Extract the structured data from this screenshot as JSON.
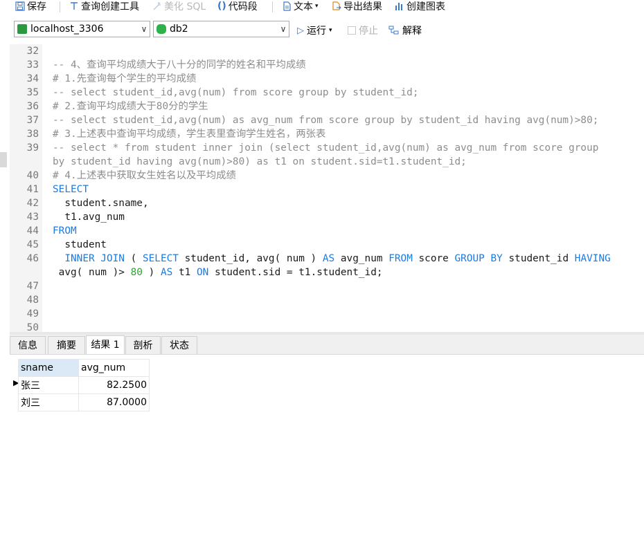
{
  "toolbar": {
    "save": "保存",
    "query_builder": "查询创建工具",
    "beautify_sql": "美化 SQL",
    "code_snippet": "代码段",
    "text": "文本",
    "export_result": "导出结果",
    "create_chart": "创建图表"
  },
  "selectors": {
    "connection": "localhost_3306",
    "database": "db2",
    "run": "运行",
    "stop": "停止",
    "explain": "解释"
  },
  "editor": {
    "lines": [
      {
        "n": "32",
        "tokens": []
      },
      {
        "n": "33",
        "tokens": [
          {
            "t": "-- 4、查询平均成绩大于八十分的同学的姓名和平均成绩",
            "c": "cm"
          }
        ]
      },
      {
        "n": "34",
        "tokens": [
          {
            "t": "# 1.先查询每个学生的平均成绩",
            "c": "cm"
          }
        ]
      },
      {
        "n": "35",
        "tokens": [
          {
            "t": "-- select student_id,avg(num) from score group by student_id;",
            "c": "cm"
          }
        ]
      },
      {
        "n": "36",
        "tokens": [
          {
            "t": "# 2.查询平均成绩大于80分的学生",
            "c": "cm"
          }
        ]
      },
      {
        "n": "37",
        "tokens": [
          {
            "t": "-- select student_id,avg(num) as avg_num from score group by student_id having avg(num)>80;",
            "c": "cm"
          }
        ]
      },
      {
        "n": "38",
        "tokens": [
          {
            "t": "# 3.上述表中查询平均成绩，学生表里查询学生姓名，两张表",
            "c": "cm"
          }
        ]
      },
      {
        "n": "39",
        "tokens": [
          {
            "t": "-- select * from student inner join (select student_id,avg(num) as avg_num from score group",
            "c": "cm"
          }
        ]
      },
      {
        "n": "",
        "tokens": [
          {
            "t": "by student_id having avg(num)>80) as t1 on student.sid=t1.student_id;",
            "c": "cm"
          }
        ]
      },
      {
        "n": "40",
        "tokens": [
          {
            "t": "# 4.上述表中获取女生姓名以及平均成绩",
            "c": "cm"
          }
        ]
      },
      {
        "n": "41",
        "tokens": [
          {
            "t": "SELECT",
            "c": "kw"
          }
        ]
      },
      {
        "n": "42",
        "tokens": [
          {
            "t": "  student.sname,",
            "c": "tx"
          }
        ]
      },
      {
        "n": "43",
        "tokens": [
          {
            "t": "  t1.avg_num",
            "c": "tx"
          }
        ]
      },
      {
        "n": "44",
        "tokens": [
          {
            "t": "FROM",
            "c": "kw"
          }
        ]
      },
      {
        "n": "45",
        "tokens": [
          {
            "t": "  student",
            "c": "tx"
          }
        ]
      },
      {
        "n": "46",
        "tokens": [
          {
            "t": "  ",
            "c": "tx"
          },
          {
            "t": "INNER JOIN",
            "c": "kw"
          },
          {
            "t": " ( ",
            "c": "tx"
          },
          {
            "t": "SELECT",
            "c": "kw"
          },
          {
            "t": " student_id, avg( num ) ",
            "c": "tx"
          },
          {
            "t": "AS",
            "c": "kw"
          },
          {
            "t": " avg_num ",
            "c": "tx"
          },
          {
            "t": "FROM",
            "c": "kw"
          },
          {
            "t": " score ",
            "c": "tx"
          },
          {
            "t": "GROUP BY",
            "c": "kw"
          },
          {
            "t": " student_id ",
            "c": "tx"
          },
          {
            "t": "HAVING",
            "c": "kw"
          }
        ]
      },
      {
        "n": "",
        "tokens": [
          {
            "t": " avg( num )> ",
            "c": "tx"
          },
          {
            "t": "80",
            "c": "num"
          },
          {
            "t": " ) ",
            "c": "tx"
          },
          {
            "t": "AS",
            "c": "kw"
          },
          {
            "t": " t1 ",
            "c": "tx"
          },
          {
            "t": "ON",
            "c": "kw"
          },
          {
            "t": " student.sid = t1.student_id;",
            "c": "tx"
          }
        ]
      },
      {
        "n": "47",
        "tokens": []
      },
      {
        "n": "48",
        "tokens": []
      },
      {
        "n": "49",
        "tokens": []
      },
      {
        "n": "50",
        "tokens": []
      }
    ]
  },
  "result_tabs": [
    "信息",
    "摘要",
    "结果 1",
    "剖析",
    "状态"
  ],
  "result": {
    "columns": [
      "sname",
      "avg_num"
    ],
    "rows": [
      [
        "张三",
        "82.2500"
      ],
      [
        "刘三",
        "87.0000"
      ]
    ],
    "current_row_marker": "▶"
  },
  "colors": {
    "keyword": "#1c7ae0",
    "comment": "#8d8d8d",
    "number": "#2ea12e",
    "header_bg": "#dbe9f7"
  }
}
